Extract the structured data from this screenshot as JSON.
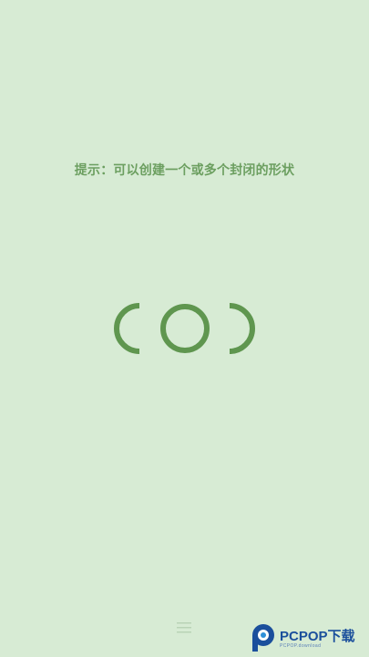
{
  "hint": {
    "text": "提示：可以创建一个或多个封闭的形状"
  },
  "puzzle": {
    "shapes": [
      "left-arc-icon",
      "circle-icon",
      "right-arc-icon"
    ],
    "stroke_color": "#5f964f"
  },
  "menu": {
    "icon": "hamburger-menu-icon",
    "color": "#b9d3b6"
  },
  "watermark": {
    "brand": "PCPOP下载",
    "sub": "PCPOP.download"
  },
  "colors": {
    "background": "#d7ebd4",
    "hint_text": "#6c9f60",
    "shape": "#5f964f"
  }
}
